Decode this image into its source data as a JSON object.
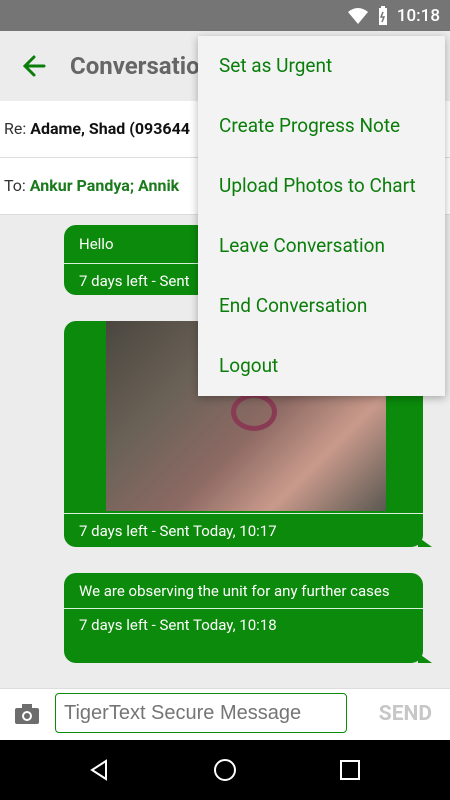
{
  "status_bar": {
    "time": "10:18"
  },
  "app_bar": {
    "title": "Conversation"
  },
  "header": {
    "re_label": "Re:",
    "re_value": "Adame, Shad (093644",
    "to_label": "To:",
    "to_value": "Ankur Pandya; Annik"
  },
  "messages": [
    {
      "text": "Hello",
      "meta": "7 days left - Sent"
    },
    {
      "meta": "7 days left - Sent Today, 10:17"
    },
    {
      "text": "We are observing the unit for any further cases",
      "meta": "7 days left - Sent Today, 10:18"
    }
  ],
  "composer": {
    "placeholder": "TigerText Secure Message",
    "send_label": "SEND"
  },
  "menu": {
    "items": [
      "Set as Urgent",
      "Create Progress Note",
      "Upload Photos to Chart",
      "Leave Conversation",
      "End Conversation",
      "Logout"
    ]
  },
  "colors": {
    "accent": "#0b8a0b",
    "menu_text": "#0b7d0b",
    "status_bar": "#757575",
    "nav_bar": "#000000"
  },
  "icons": [
    "wifi-icon",
    "battery-icon",
    "back-arrow-icon",
    "camera-icon",
    "nav-back-icon",
    "nav-home-icon",
    "nav-recents-icon"
  ]
}
